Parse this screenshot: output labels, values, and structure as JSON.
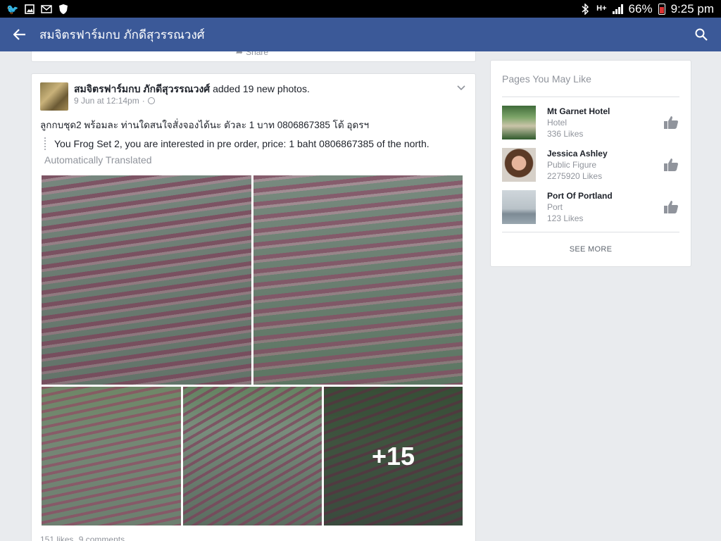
{
  "status_bar": {
    "battery": "66%",
    "time": "9:25 pm",
    "network": "H+"
  },
  "app_bar": {
    "title": "สมจิตรฟาร์มกบ ภักดีสุวรรณวงศ์"
  },
  "prev_card": {
    "share_label": "Share"
  },
  "post": {
    "author": "สมจิตรฟาร์มกบ ภักดีสุวรรณวงศ์",
    "action": "added 19 new photos.",
    "timestamp": "9 Jun at 12:14pm",
    "separator": "·",
    "original_text": "ลูกกบชุด2 พร้อมละ ท่านใดสนใจสั่งจองได้นะ ตัวละ 1 บาท 0806867385 โต้ อุดรฯ",
    "translation": "You Frog Set 2, you are interested in pre order, price: 1 baht 0806867385 of the north.",
    "auto_translated": "Automatically Translated",
    "more_photos": "+15",
    "likes": "151 likes",
    "comments": "9 comments"
  },
  "sidebar": {
    "title": "Pages You May Like",
    "pages": [
      {
        "name": "Mt Garnet Hotel",
        "category": "Hotel",
        "likes": "336 Likes"
      },
      {
        "name": "Jessica Ashley",
        "category": "Public Figure",
        "likes": "2275920 Likes"
      },
      {
        "name": "Port Of Portland",
        "category": "Port",
        "likes": "123 Likes"
      }
    ],
    "see_more": "SEE MORE"
  },
  "colors": {
    "app_bar": "#3b5998",
    "background": "#e9ebee",
    "muted_text": "#90949c"
  }
}
